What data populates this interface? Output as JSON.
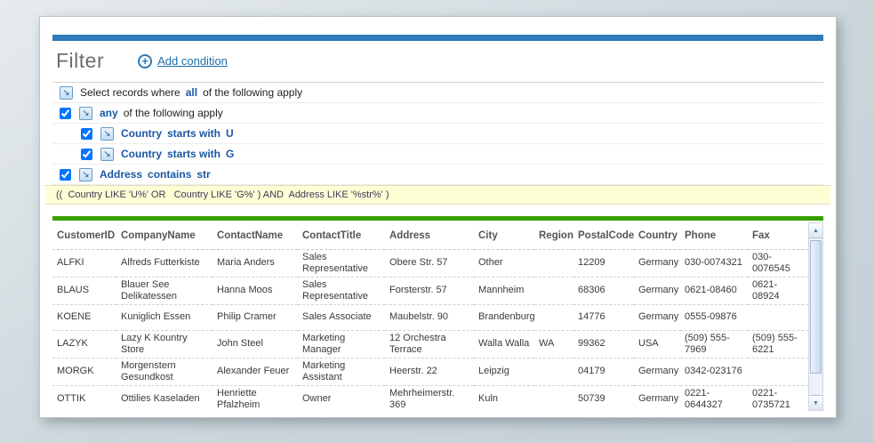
{
  "colors": {
    "accent_bar": "#2e7ab8",
    "green_divider": "#35a000",
    "expression_bg": "#ffffd6",
    "link": "#1b6ea9",
    "keyword": "#1a57a5"
  },
  "icons": {
    "node_arrow": "↘",
    "plus": "+",
    "scroll_up": "▲",
    "scroll_down": "▼"
  },
  "filter_panel": {
    "title": "Filter",
    "add_condition_label": "Add condition",
    "root_row": {
      "prefix": "Select records where",
      "operator": "all",
      "suffix": "of the following apply"
    },
    "group_row": {
      "operator": "any",
      "suffix": "of the following apply",
      "checked": true
    },
    "conditions": [
      {
        "field": "Country",
        "operator": "starts with",
        "value": "U",
        "checked": true
      },
      {
        "field": "Country",
        "operator": "starts with",
        "value": "G",
        "checked": true
      },
      {
        "field": "Address",
        "operator": "contains",
        "value": "str",
        "checked": true
      }
    ],
    "expression": "((  Country LIKE 'U%' OR   Country LIKE 'G%' ) AND  Address LIKE '%str%' )"
  },
  "table": {
    "columns": [
      "CustomerID",
      "CompanyName",
      "ContactName",
      "ContactTitle",
      "Address",
      "City",
      "Region",
      "PostalCode",
      "Country",
      "Phone",
      "Fax"
    ],
    "rows": [
      [
        "ALFKI",
        "Alfreds Futterkiste",
        "Maria Anders",
        "Sales Representative",
        "Obere Str. 57",
        "Other",
        "",
        "12209",
        "Germany",
        "030-0074321",
        "030-0076545"
      ],
      [
        "BLAUS",
        "Blauer See Delikatessen",
        "Hanna Moos",
        "Sales Representative",
        "Forsterstr. 57",
        "Mannheim",
        "",
        "68306",
        "Germany",
        "0621-08460",
        "0621-08924"
      ],
      [
        "KOENE",
        "Kuniglich Essen",
        "Philip Cramer",
        "Sales Associate",
        "Maubelstr. 90",
        "Brandenburg",
        "",
        "14776",
        "Germany",
        "0555-09876",
        ""
      ],
      [
        "LAZYK",
        "Lazy K Kountry Store",
        "John Steel",
        "Marketing Manager",
        "12 Orchestra Terrace",
        "Walla Walla",
        "WA",
        "99362",
        "USA",
        "(509) 555-7969",
        "(509) 555-6221"
      ],
      [
        "MORGK",
        "Morgenstern Gesundkost",
        "Alexander Feuer",
        "Marketing Assistant",
        "Heerstr. 22",
        "Leipzig",
        "",
        "04179",
        "Germany",
        "0342-023176",
        ""
      ],
      [
        "OTTIK",
        "Ottilies Kaseladen",
        "Henriette Pfalzheim",
        "Owner",
        "Mehrheimerstr. 369",
        "Kuln",
        "",
        "50739",
        "Germany",
        "0221-0644327",
        "0221-0735721"
      ]
    ]
  }
}
